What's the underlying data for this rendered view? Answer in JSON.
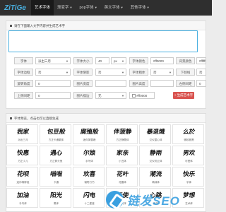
{
  "nav": {
    "logo": "ZiTiGe",
    "tabs": [
      {
        "label": "艺术字体"
      },
      {
        "label": "渐变字"
      },
      {
        "label": "pop字体"
      },
      {
        "label": "英文字体"
      },
      {
        "label": "其他字体"
      }
    ]
  },
  "form": {
    "header": "请在下面输入文字内容并生成艺术字",
    "text_value": "",
    "font_label": "字体",
    "font_value": "派出三月",
    "size_label": "字体大小",
    "size_value": "40",
    "size_unit": "px",
    "color_label": "字体颜色",
    "color_value": "#ff0000",
    "bg_label": "背景颜色",
    "bg_value": "#ffffff",
    "outline_label": "字体边框",
    "outline_value": "否",
    "shadow_label": "字体阴影",
    "shadow_value": "否",
    "bold_label": "字体粗体",
    "bold_value": "否",
    "underline_label": "下划线",
    "underline_value": "否",
    "rotate_label": "旋转角度",
    "rotate_value": "0",
    "width_label": "图片宽度",
    "width_value": "",
    "height_label": "图片高度",
    "height_value": "",
    "pos_label": "左侧间距",
    "pos_value": "0",
    "top_label": "上侧间距",
    "top_value": "0",
    "border_label": "图片描边",
    "border_value": "无",
    "border_color": "#ff0000",
    "submit_label": "生成艺术字",
    "colors": {
      "accent": "#337ab7",
      "danger": "#d9534f",
      "nav_bg": "#2f2f2f"
    }
  },
  "gallery": {
    "header": "字体预览，点击也可以直接生成",
    "items": [
      {
        "art": "我家",
        "caption": "派出三月"
      },
      {
        "art": "包豆般",
        "caption": "方正卡通繁体"
      },
      {
        "art": "腐殖般",
        "caption": "迷你简雪峰"
      },
      {
        "art": "伴菠静",
        "caption": "方正静蕾体"
      },
      {
        "art": "暴退熾",
        "caption": "汉仪菱心体"
      },
      {
        "art": "么於",
        "caption": "微软雅黑"
      },
      {
        "art": "快惠",
        "caption": "方正少儿"
      },
      {
        "art": "遇心",
        "caption": "方正胖头鱼"
      },
      {
        "art": "尔娘",
        "caption": "手写体"
      },
      {
        "art": "家亲",
        "caption": "小丑体"
      },
      {
        "art": "静雨",
        "caption": "汉仪彩云体"
      },
      {
        "art": "男欢",
        "caption": "可爱体"
      },
      {
        "art": "花呗",
        "caption": "迷你简胖娃"
      },
      {
        "art": "喵喵",
        "caption": "卡通"
      },
      {
        "art": "欢喜",
        "caption": "钢笔行书"
      },
      {
        "art": "花叶",
        "caption": "花瓣体"
      },
      {
        "art": "潮流",
        "caption": "萌妹体"
      },
      {
        "art": "快乐",
        "caption": "字体"
      },
      {
        "art": "加油",
        "caption": "手写体"
      },
      {
        "art": "阳光",
        "caption": "黑体"
      },
      {
        "art": "闪电",
        "caption": "十二星座"
      },
      {
        "art": "天使",
        "caption": "力力体"
      },
      {
        "art": "心跳",
        "caption": "美体"
      },
      {
        "art": "梦想",
        "caption": "艺术体"
      }
    ]
  },
  "watermark": {
    "text": "链发SEO"
  }
}
